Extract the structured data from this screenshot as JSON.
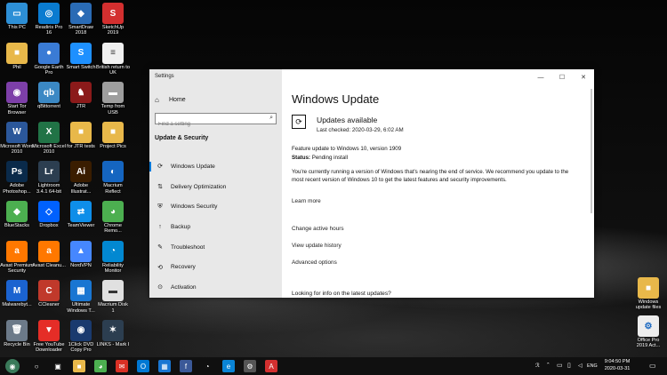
{
  "desktop_icons": [
    {
      "label": "This PC",
      "icon": "computer-icon",
      "color": "#2d8fd6",
      "glyph": "▭"
    },
    {
      "label": "Phil",
      "icon": "user-folder-icon",
      "color": "#e8b84a",
      "glyph": "■"
    },
    {
      "label": "Start Tor Browser",
      "icon": "tor-icon",
      "color": "#7d3fa8",
      "glyph": "◉"
    },
    {
      "label": "Microsoft Word 2010",
      "icon": "word-icon",
      "color": "#2b579a",
      "glyph": "W"
    },
    {
      "label": "Adobe Photoshop...",
      "icon": "photoshop-icon",
      "color": "#0a2a4a",
      "glyph": "Ps"
    },
    {
      "label": "BlueStacks",
      "icon": "bluestacks-icon",
      "color": "#4caf50",
      "glyph": "◆"
    },
    {
      "label": "Avast Premium Security",
      "icon": "avast-icon",
      "color": "#ff7800",
      "glyph": "a"
    },
    {
      "label": "Malwarebyt...",
      "icon": "malwarebytes-icon",
      "color": "#1b63d0",
      "glyph": "M"
    },
    {
      "label": "Recycle Bin",
      "icon": "recycle-bin-icon",
      "color": "#6c7a89",
      "glyph": "🗑"
    },
    {
      "label": "Readiris Pro 16",
      "icon": "readiris-icon",
      "color": "#0a7bd0",
      "glyph": "◎"
    },
    {
      "label": "Google Earth Pro",
      "icon": "google-earth-icon",
      "color": "#3a7bd5",
      "glyph": "●"
    },
    {
      "label": "qBittorrent",
      "icon": "qbittorrent-icon",
      "color": "#3b88c4",
      "glyph": "qb"
    },
    {
      "label": "Microsoft Excel 2010",
      "icon": "excel-icon",
      "color": "#217346",
      "glyph": "X"
    },
    {
      "label": "Lightroom 3.4.1 64-bit",
      "icon": "lightroom-icon",
      "color": "#2c3e50",
      "glyph": "Lr"
    },
    {
      "label": "Dropbox",
      "icon": "dropbox-icon",
      "color": "#0061fe",
      "glyph": "◇"
    },
    {
      "label": "Avast Cleanu...",
      "icon": "avast-cleanup-icon",
      "color": "#ff7800",
      "glyph": "a"
    },
    {
      "label": "CCleaner",
      "icon": "ccleaner-icon",
      "color": "#c0392b",
      "glyph": "C"
    },
    {
      "label": "Free YouTube Downloader",
      "icon": "youtube-downloader-icon",
      "color": "#e52d27",
      "glyph": "▼"
    },
    {
      "label": "SmartDraw 2018",
      "icon": "smartdraw-icon",
      "color": "#2a6bb5",
      "glyph": "◆"
    },
    {
      "label": "Smart Switch",
      "icon": "smart-switch-icon",
      "color": "#1e90ff",
      "glyph": "S"
    },
    {
      "label": "JTR",
      "icon": "jtr-icon",
      "color": "#8b1a1a",
      "glyph": "♞"
    },
    {
      "label": "for JTR tests",
      "icon": "folder-icon",
      "color": "#e8b84a",
      "glyph": "■"
    },
    {
      "label": "Adobe Illustrat...",
      "icon": "illustrator-icon",
      "color": "#3a1d00",
      "glyph": "Ai"
    },
    {
      "label": "TeamViewer",
      "icon": "teamviewer-icon",
      "color": "#0e8ee9",
      "glyph": "⇄"
    },
    {
      "label": "NordVPN",
      "icon": "nordvpn-icon",
      "color": "#4687ff",
      "glyph": "▲"
    },
    {
      "label": "Ultimate Windows T...",
      "icon": "ultimate-windows-icon",
      "color": "#1976d2",
      "glyph": "▦"
    },
    {
      "label": "1Click DVD Copy Pro",
      "icon": "dvd-copy-icon",
      "color": "#1a3a6e",
      "glyph": "◉"
    },
    {
      "label": "SketchUp 2019",
      "icon": "sketchup-icon",
      "color": "#d32f2f",
      "glyph": "S"
    },
    {
      "label": "British return to UK",
      "icon": "document-icon",
      "color": "#f0f0f0",
      "glyph": "≡"
    },
    {
      "label": "Temp from USB",
      "icon": "usb-drive-icon",
      "color": "#9e9e9e",
      "glyph": "▬"
    },
    {
      "label": "Project Pics",
      "icon": "folder-icon",
      "color": "#e8b84a",
      "glyph": "■"
    },
    {
      "label": "Macrium Reflect",
      "icon": "macrium-icon",
      "color": "#1565c0",
      "glyph": "◐"
    },
    {
      "label": "Chrome Remo...",
      "icon": "chrome-remote-icon",
      "color": "#4caf50",
      "glyph": "◕"
    },
    {
      "label": "Reliability Monitor",
      "icon": "reliability-icon",
      "color": "#0288d1",
      "glyph": "◔"
    },
    {
      "label": "Macrium Disk 1",
      "icon": "macrium-disk-icon",
      "color": "#e0e0e0",
      "glyph": "▬"
    },
    {
      "label": "LINKS - Mark I",
      "icon": "links-icon",
      "color": "#2c3e50",
      "glyph": "✶"
    }
  ],
  "right_icons": [
    {
      "label": "Windows update files",
      "icon": "folder-icon",
      "color": "#e8b84a",
      "glyph": "■"
    },
    {
      "label": "Office Pro 2019 Act...",
      "icon": "batch-file-icon",
      "color": "#eeeeee",
      "glyph": "⚙"
    }
  ],
  "settings": {
    "window_title": "Settings",
    "home_label": "Home",
    "search_placeholder": "Find a setting",
    "section_title": "Update & Security",
    "nav": [
      {
        "label": "Windows Update",
        "icon": "sync-icon",
        "glyph": "⟳",
        "active": true
      },
      {
        "label": "Delivery Optimization",
        "icon": "delivery-icon",
        "glyph": "⇅",
        "active": false
      },
      {
        "label": "Windows Security",
        "icon": "shield-icon",
        "glyph": "⛨",
        "active": false
      },
      {
        "label": "Backup",
        "icon": "backup-icon",
        "glyph": "↑",
        "active": false
      },
      {
        "label": "Troubleshoot",
        "icon": "wrench-icon",
        "glyph": "✎",
        "active": false
      },
      {
        "label": "Recovery",
        "icon": "recovery-icon",
        "glyph": "⟲",
        "active": false
      },
      {
        "label": "Activation",
        "icon": "activation-icon",
        "glyph": "⊙",
        "active": false
      }
    ],
    "controls": {
      "minimize": "—",
      "maximize": "☐",
      "close": "✕"
    },
    "main": {
      "heading": "Windows Update",
      "updates_title": "Updates available",
      "last_checked": "Last checked: 2020-03-29, 6:02 AM",
      "feature": "Feature update to Windows 10, version 1909",
      "status_label": "Status:",
      "status_value": "Pending install",
      "description": "You're currently running a version of Windows that's nearing the end of service. We recommend you update to the most recent version of Windows 10 to get the latest features and security improvements.",
      "learn_more": "Learn more",
      "change_hours": "Change active hours",
      "view_history": "View update history",
      "advanced": "Advanced options",
      "looking": "Looking for info on the latest updates?"
    }
  },
  "taskbar": {
    "apps": [
      {
        "icon": "start-icon",
        "glyph": "◉",
        "color": "#3a7a5a"
      },
      {
        "icon": "cortana-icon",
        "glyph": "○",
        "color": "transparent"
      },
      {
        "icon": "photos-icon",
        "glyph": "▣",
        "color": "transparent"
      },
      {
        "icon": "file-explorer-icon",
        "glyph": "■",
        "color": "#e8b84a"
      },
      {
        "icon": "chrome-icon",
        "glyph": "◕",
        "color": "#4caf50"
      },
      {
        "icon": "gmail-icon",
        "glyph": "✉",
        "color": "#d93025"
      },
      {
        "icon": "outlook-icon",
        "glyph": "O",
        "color": "#0078d4"
      },
      {
        "icon": "calendar-icon",
        "glyph": "▦",
        "color": "#1976d2"
      },
      {
        "icon": "facebook-icon",
        "glyph": "f",
        "color": "#3b5998"
      },
      {
        "icon": "speedometer-icon",
        "glyph": "◔",
        "color": "transparent"
      },
      {
        "icon": "edge-icon",
        "glyph": "e",
        "color": "#0a84d6"
      },
      {
        "icon": "settings-icon",
        "glyph": "⚙",
        "color": "#555555"
      },
      {
        "icon": "acrobat-icon",
        "glyph": "A",
        "color": "#d32f2f"
      }
    ],
    "tray_lang": "ENG",
    "time": "9:04:50 PM",
    "date": "2020-03-31"
  }
}
